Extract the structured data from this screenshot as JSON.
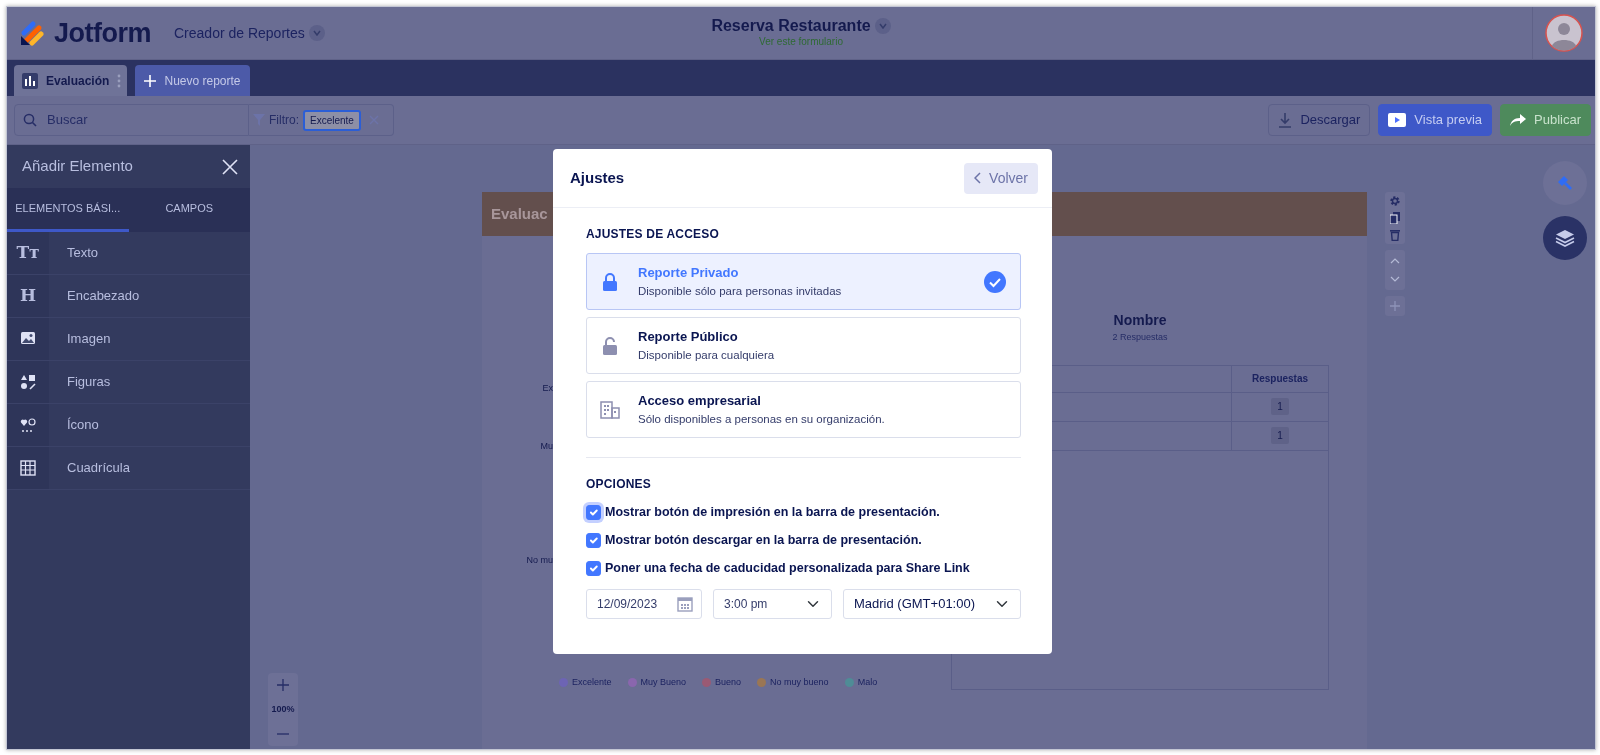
{
  "header": {
    "logo": "Jotform",
    "app_menu": "Creador de Reportes",
    "form_title": "Reserva Restaurante",
    "form_link": "Ver este formulario"
  },
  "report_tabs": [
    {
      "label": "Evaluación",
      "selected": true
    }
  ],
  "new_report_button": "Nuevo reporte",
  "toolbar": {
    "search_placeholder": "Buscar",
    "filter_label": "Filtro:",
    "filter_value": "Excelente",
    "buttons": [
      {
        "label": "Descargar",
        "kind": "download"
      },
      {
        "label": "Vista previa",
        "kind": "preview"
      },
      {
        "label": "Publicar",
        "kind": "publish"
      }
    ]
  },
  "sidebar": {
    "title": "Añadir Elemento",
    "tabs": [
      {
        "label": "ELEMENTOS BÁSI...",
        "selected": true
      },
      {
        "label": "CAMPOS",
        "selected": false
      }
    ],
    "items": [
      {
        "label": "Texto",
        "kind": "text",
        "icon_text": "Tᴛ"
      },
      {
        "label": "Encabezado",
        "kind": "heading",
        "icon_text": "H"
      },
      {
        "label": "Imagen",
        "kind": "image"
      },
      {
        "label": "Figuras",
        "kind": "shapes"
      },
      {
        "label": "Ícono",
        "kind": "icon"
      },
      {
        "label": "Cuadrícula",
        "kind": "grid"
      }
    ]
  },
  "report": {
    "title": "Evaluac",
    "chart_labels": [
      "Ex",
      "Mu",
      "No mu"
    ],
    "legend": [
      {
        "label": "Excelente",
        "color": "#6d64b4"
      },
      {
        "label": "Muy Bueno",
        "color": "#8a66ae"
      },
      {
        "label": "Bueno",
        "color": "#9a5a74"
      },
      {
        "label": "No muy bueno",
        "color": "#9a7654"
      },
      {
        "label": "Malo",
        "color": "#4f8c96"
      }
    ],
    "table_title": "Nombre",
    "table_subtitle": "2 Respuestas",
    "table": {
      "columns": [
        "Respuestas"
      ],
      "rows": [
        [
          "1"
        ],
        [
          "1"
        ]
      ]
    }
  },
  "zoom": {
    "level_text": "100%"
  },
  "modal": {
    "title": "Ajustes",
    "back_button": "Volver",
    "access_heading": "AJUSTES DE ACCESO",
    "access_options": [
      {
        "title": "Reporte Privado",
        "description": "Disponible sólo para personas invitadas",
        "kind": "private",
        "selected": true
      },
      {
        "title": "Reporte Público",
        "description": "Disponible para cualquiera",
        "kind": "public",
        "selected": false
      },
      {
        "title": "Acceso empresarial",
        "description": "Sólo disponibles a personas en su organización.",
        "kind": "enterprise",
        "selected": false
      }
    ],
    "options_heading": "OPCIONES",
    "options": [
      {
        "label": "Mostrar botón de impresión en la barra de presentación.",
        "checked": true,
        "focused": true
      },
      {
        "label": "Mostrar botón descargar en la barra de presentación.",
        "checked": true,
        "focused": false
      },
      {
        "label": "Poner una fecha de caducidad personalizada para Share Link",
        "checked": true,
        "focused": false
      }
    ],
    "expiry": {
      "date": "12/09/2023",
      "time": "3:00 pm",
      "timezone": "Madrid (GMT+01:00)"
    }
  }
}
